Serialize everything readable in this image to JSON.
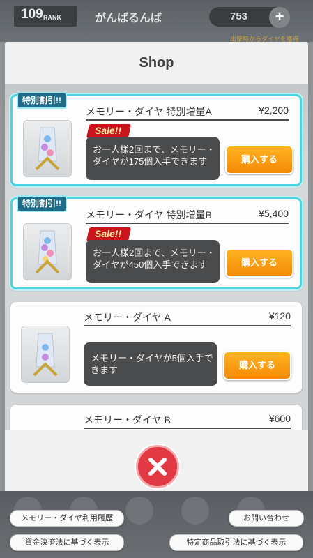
{
  "header": {
    "rank": "109",
    "rank_label": "RANK",
    "player_name": "がんばるんば",
    "diamonds": "753",
    "promo": "出撃時からダイヤを獲得"
  },
  "shop": {
    "title": "Shop",
    "items": [
      {
        "tag": "特別割引!!",
        "name": "メモリー・ダイヤ 特別増量A",
        "price": "¥2,200",
        "sale": "Sale!!",
        "description": "お一人様2回まで、メモリー・ダイヤが175個入手できます",
        "buy_label": "購入する"
      },
      {
        "tag": "特別割引!!",
        "name": "メモリー・ダイヤ 特別増量B",
        "price": "¥5,400",
        "sale": "Sale!!",
        "description": "お一人様2回まで、メモリー・ダイヤが450個入手できます",
        "buy_label": "購入する"
      },
      {
        "name": "メモリー・ダイヤ A",
        "price": "¥120",
        "description": "メモリー・ダイヤが5個入手できます",
        "buy_label": "購入する"
      },
      {
        "name": "メモリー・ダイヤ B",
        "price": "¥600"
      }
    ],
    "close_icon": "close-x-icon"
  },
  "footer_links": {
    "history": "メモリー・ダイヤ利用履歴",
    "contact": "お問い合わせ",
    "settlement_law": "資金決済法に基づく表示",
    "commercial_law": "特定商品取引法に基づく表示"
  },
  "colors": {
    "accent_orange": "#f48a05",
    "special_border": "#4fd3df",
    "close_red": "#e23a44",
    "sale_red": "#c8141a"
  }
}
